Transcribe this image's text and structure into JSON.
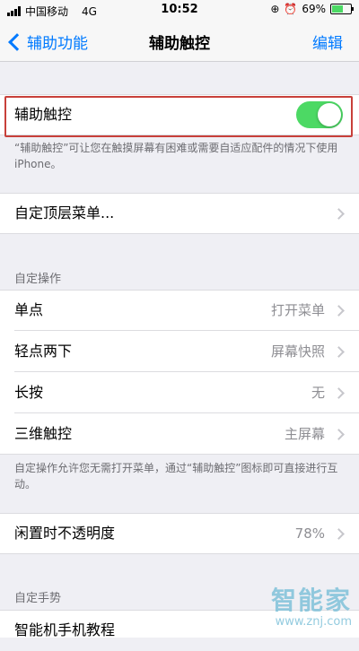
{
  "status_bar": {
    "carrier": "中国移动",
    "network": "4G",
    "time": "10:52",
    "battery_percent": "69%",
    "battery_level": 0.69
  },
  "nav": {
    "back_label": "辅助功能",
    "title": "辅助触控",
    "edit_label": "编辑"
  },
  "assistive_touch": {
    "label": "辅助触控",
    "enabled": true,
    "footnote": "“辅助触控”可让您在触摸屏幕有困难或需要自适应配件的情况下使用 iPhone。"
  },
  "customize_menu": {
    "label": "自定顶层菜单..."
  },
  "custom_actions": {
    "header": "自定操作",
    "items": [
      {
        "label": "单点",
        "value": "打开菜单"
      },
      {
        "label": "轻点两下",
        "value": "屏幕快照"
      },
      {
        "label": "长按",
        "value": "无"
      },
      {
        "label": "三维触控",
        "value": "主屏幕"
      }
    ],
    "footnote": "自定操作允许您无需打开菜单，通过“辅助触控”图标即可直接进行互动。"
  },
  "idle_opacity": {
    "label": "闲置时不透明度",
    "value": "78%"
  },
  "custom_gestures": {
    "header": "自定手势",
    "partial_row": "智能机手机教程"
  },
  "watermark": {
    "logo": "智能家",
    "url": "www.znj.com"
  },
  "colors": {
    "accent": "#007aff",
    "toggle_on": "#4cd964",
    "highlight": "#c8403a",
    "background": "#efeff4"
  }
}
